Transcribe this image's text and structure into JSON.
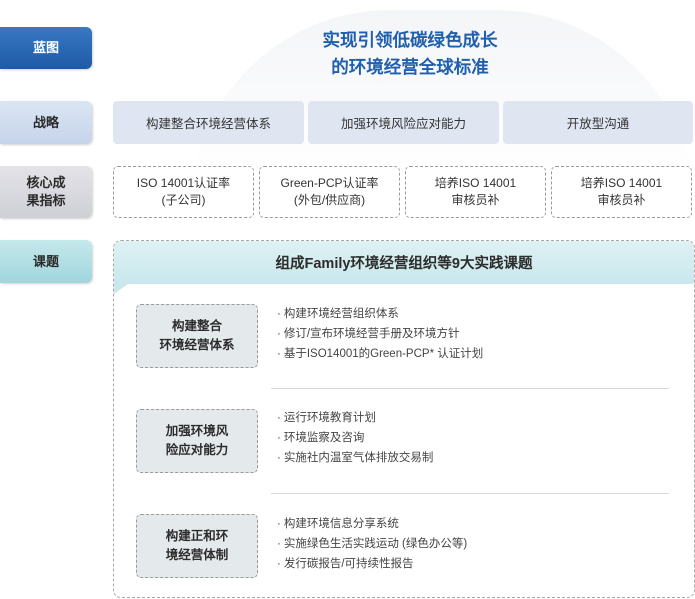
{
  "rows": {
    "blueprint": "蓝图",
    "strategy": "战略",
    "kpi_line1": "核心成",
    "kpi_line2": "果指标",
    "task": "课题"
  },
  "blueprint": {
    "line1": "实现引领低碳绿色成长",
    "line2": "的环境经营全球标准"
  },
  "strategies": [
    "构建整合环境经营体系",
    "加强环境风险应对能力",
    "开放型沟通"
  ],
  "kpis": [
    {
      "line1": "ISO 14001认证率",
      "line2": "(子公司)"
    },
    {
      "line1": "Green-PCP认证率",
      "line2": "(外包/供应商)"
    },
    {
      "line1": "培养ISO 14001",
      "line2": "审核员补"
    },
    {
      "line1": "培养ISO 14001",
      "line2": "审核员补"
    }
  ],
  "task_header": "组成Family环境经营组织等9大实践课题",
  "practices": [
    {
      "line1": "构建整合",
      "line2": "环境经营体系",
      "items": [
        "构建环境经营组织体系",
        "修订/宣布环境经营手册及环境方针",
        "基于ISO14001的Green-PCP* 认证计划"
      ]
    },
    {
      "line1": "加强环境风",
      "line2": "险应对能力",
      "items": [
        "运行环境教育计划",
        "环境监察及咨询",
        "实施社内温室气体排放交易制"
      ]
    },
    {
      "line1": "构建正和环",
      "line2": "境经营体制",
      "items": [
        "构建环境信息分享系统",
        "实施绿色生活实践运动 (绿色办公等)",
        "发行碳报告/可持续性报告"
      ]
    }
  ]
}
